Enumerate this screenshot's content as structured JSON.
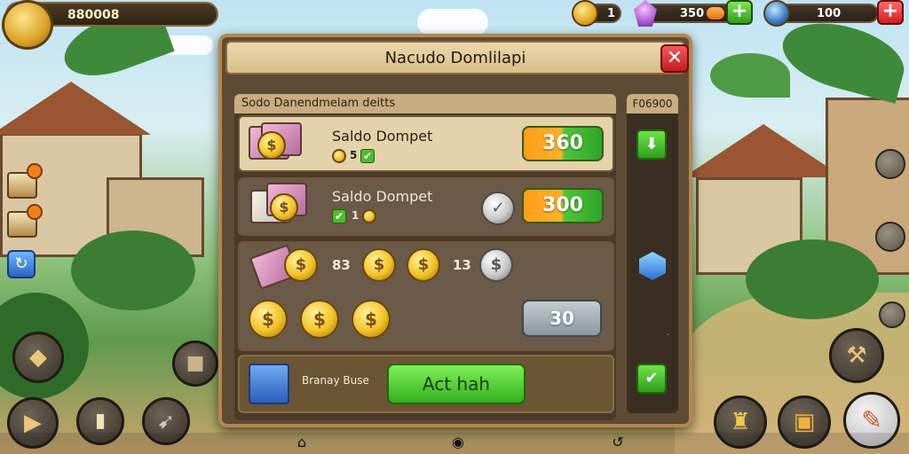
{
  "hud": {
    "gold": "880008",
    "coins": "1",
    "gems": "350",
    "gems_fill_percent": 40,
    "energy": "100"
  },
  "dialog": {
    "title": "Nacudo Domlilapi",
    "close_symbol": "✕",
    "list_header": "Sodo Danendmelam deitts",
    "side_header": "F06900",
    "rows": [
      {
        "label": "Saldo Dompet",
        "mini_value": "5",
        "amount": "360"
      },
      {
        "label": "Saldo Dompet",
        "mini_value": "1",
        "amount": "300"
      }
    ],
    "coin_row": {
      "value_a": "83",
      "value_b": "13"
    },
    "grey_amount": "30",
    "footer_label": "Branay Buse",
    "action_label": "Act hah"
  },
  "icons": {
    "download": "⬇",
    "check": "✔",
    "plus": "+",
    "refresh": "↻"
  },
  "colors": {
    "accent_green": "#34b01f",
    "accent_orange": "#ff9d1a",
    "close_red": "#c81b20",
    "panel_brown": "#5e4b35"
  }
}
